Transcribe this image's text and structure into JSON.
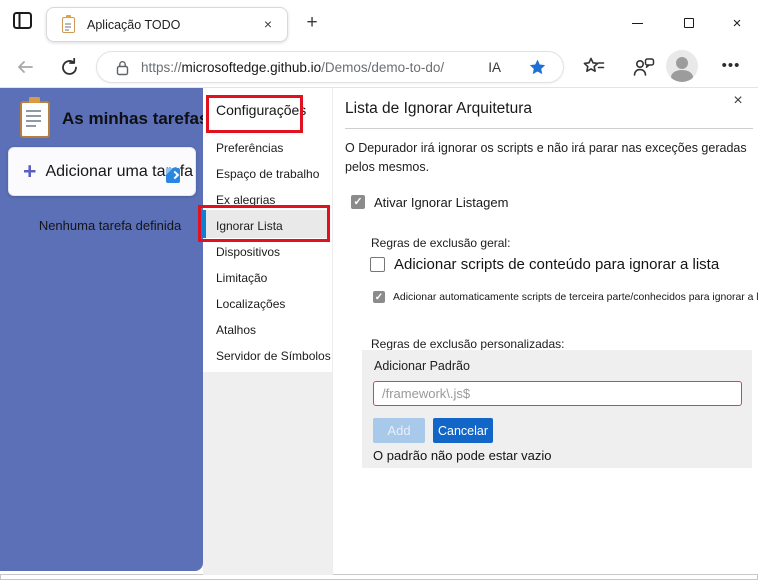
{
  "browser": {
    "tab_title": "Aplicação TODO",
    "close_tab": "×",
    "new_tab": "+",
    "window_close": "×",
    "more_label": "•••",
    "url": {
      "protocol": "https://",
      "host": "microsoftedge.github.io",
      "path": "/Demos/demo-to-do/",
      "badge": "IA"
    }
  },
  "todo": {
    "title": "As minhas tarefas",
    "add_plus": "+",
    "add_button": "Adicionar uma tarefa",
    "empty_message": "Nenhuma tarefa definida"
  },
  "settings": {
    "title": "Configurações",
    "items": [
      "Preferências",
      "Espaço de trabalho",
      "Ex alegrias",
      "Ignorar Lista",
      "Dispositivos",
      "Limitação",
      "Localizações",
      "Atalhos",
      "Servidor de Símbolos"
    ],
    "selected_item": "Ignorar Lista"
  },
  "panel": {
    "close": "×",
    "title": "Lista de Ignorar Arquitetura",
    "description": "O Depurador irá ignorar os scripts e não irá parar nas exceções geradas pelos mesmos.",
    "check_glyph": "✓",
    "enable_label": "Ativar Ignorar Listagem",
    "general_rules_label": "Regras de exclusão geral:",
    "content_scripts_label": "Adicionar scripts de conteúdo para ignorar a lista",
    "third_party_label": "Adicionar automaticamente scripts de terceira parte/conhecidos para ignorar a lista",
    "custom_rules_label": "Regras de exclusão personalizadas:",
    "add_pattern_label": "Adicionar Padrão",
    "pattern_value": "/framework\\.js$",
    "add_button": "Add",
    "cancel_button": "Cancelar",
    "error_message": "O padrão não pode estar vazio"
  },
  "colors": {
    "sidebar_blue": "#5b70b7",
    "annotation_red": "#e0121f",
    "selected_accent_blue": "#0f7ed8",
    "cancel_button_blue": "#1266c8",
    "favorite_star_blue": "#1e70d6",
    "input_error_border": "#cf4a44",
    "custom_box_gray": "#efefef"
  }
}
